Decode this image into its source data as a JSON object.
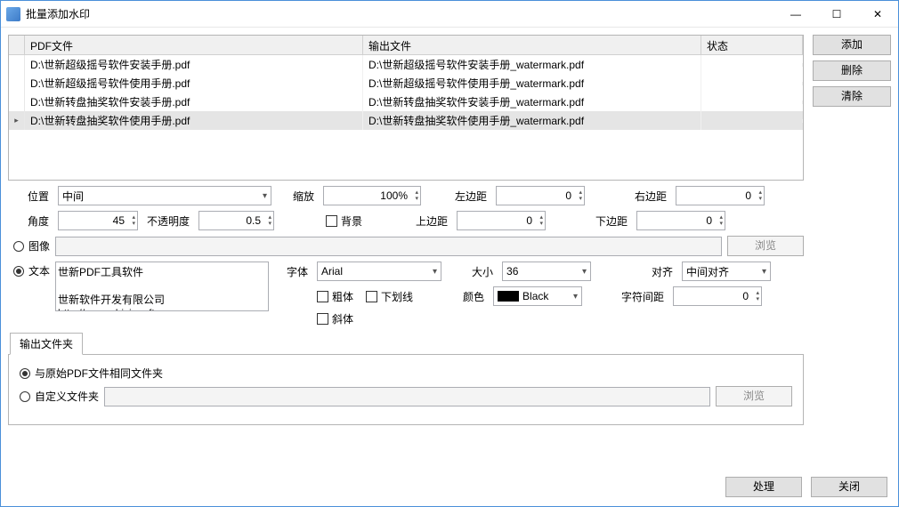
{
  "window": {
    "title": "批量添加水印"
  },
  "buttons": {
    "add": "添加",
    "delete": "删除",
    "clear": "清除",
    "browse": "浏览",
    "process": "处理",
    "close": "关闭"
  },
  "grid": {
    "headers": {
      "pdf": "PDF文件",
      "output": "输出文件",
      "status": "状态"
    },
    "rows": [
      {
        "pdf": "D:\\世新超级摇号软件安装手册.pdf",
        "out": "D:\\世新超级摇号软件安装手册_watermark.pdf",
        "status": ""
      },
      {
        "pdf": "D:\\世新超级摇号软件使用手册.pdf",
        "out": "D:\\世新超级摇号软件使用手册_watermark.pdf",
        "status": ""
      },
      {
        "pdf": "D:\\世新转盘抽奖软件安装手册.pdf",
        "out": "D:\\世新转盘抽奖软件安装手册_watermark.pdf",
        "status": ""
      },
      {
        "pdf": "D:\\世新转盘抽奖软件使用手册.pdf",
        "out": "D:\\世新转盘抽奖软件使用手册_watermark.pdf",
        "status": "",
        "selected": true
      }
    ]
  },
  "labels": {
    "position": "位置",
    "scale": "缩放",
    "left_margin": "左边距",
    "right_margin": "右边距",
    "angle": "角度",
    "opacity": "不透明度",
    "background": "背景",
    "top_margin": "上边距",
    "bottom_margin": "下边距",
    "image": "图像",
    "text": "文本",
    "font": "字体",
    "size": "大小",
    "align": "对齐",
    "bold": "粗体",
    "underline": "下划线",
    "color": "颜色",
    "char_spacing": "字符间距",
    "italic": "斜体",
    "output_folder_tab": "输出文件夹",
    "same_folder": "与原始PDF文件相同文件夹",
    "custom_folder": "自定义文件夹"
  },
  "values": {
    "position": "中间",
    "scale": "100%",
    "left_margin": "0",
    "right_margin": "0",
    "angle": "45",
    "opacity": "0.5",
    "top_margin": "0",
    "bottom_margin": "0",
    "image_path": "",
    "text": "世新PDF工具软件\n\n世新软件开发有限公司\nhttp://www.shixinsoft.com",
    "font": "Arial",
    "size": "36",
    "align": "中间对齐",
    "color": "Black",
    "char_spacing": "0",
    "custom_folder_path": ""
  }
}
